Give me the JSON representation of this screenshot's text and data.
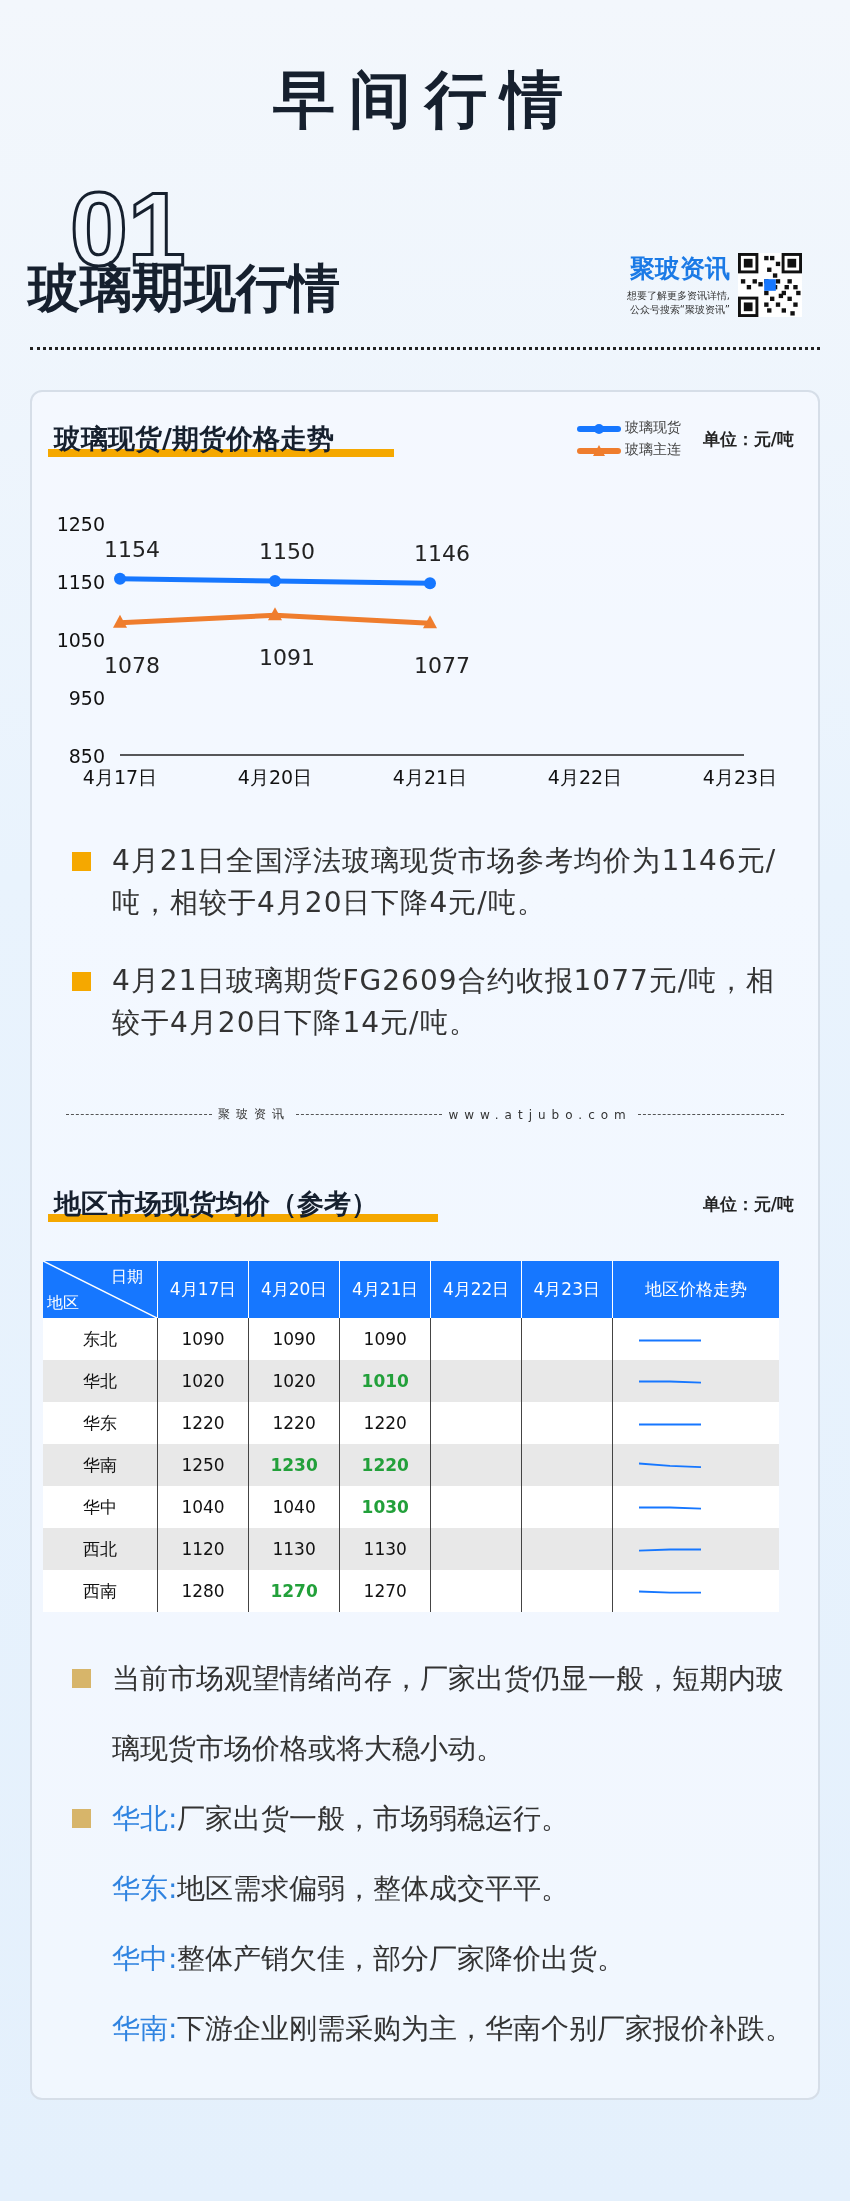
{
  "page_title": "早间行情",
  "section": {
    "number": "01",
    "title": "玻璃期现行情"
  },
  "brand": {
    "name": "聚玻资讯",
    "lines": [
      "想要了解更多资讯详情,",
      "公众号搜索“聚玻资讯”"
    ]
  },
  "price_chart": {
    "heading": "玻璃现货/期货价格走势",
    "unit": "单位：元/吨",
    "chart_data": {
      "type": "line",
      "categories": [
        "4月17日",
        "4月20日",
        "4月21日",
        "4月22日",
        "4月23日"
      ],
      "ylim": [
        850,
        1250
      ],
      "yticks": [
        850,
        950,
        1050,
        1150,
        1250
      ],
      "data_labels": true,
      "series": [
        {
          "name": "玻璃现货",
          "color": "#1677ff",
          "marker": "circle",
          "values": [
            1154,
            1150,
            1146,
            null,
            null
          ]
        },
        {
          "name": "玻璃主连",
          "color": "#ef7d2d",
          "marker": "triangle",
          "values": [
            1078,
            1091,
            1077,
            null,
            null
          ]
        }
      ]
    }
  },
  "summary_bullets": [
    "4月21日全国浮法玻璃现货市场参考均价为1146元/吨，相较于4月20日下降4元/吨。",
    "4月21日玻璃期货FG2609合约收报1077元/吨，相较于4月20日下降14元/吨。"
  ],
  "divider": {
    "brand": "聚玻资讯",
    "site": "www.atjubo.com"
  },
  "region_table": {
    "heading": "地区市场现货均价（参考）",
    "unit": "单位：元/吨",
    "corner_top": "日期",
    "corner_bottom": "地区",
    "columns": [
      "4月17日",
      "4月20日",
      "4月21日",
      "4月22日",
      "4月23日"
    ],
    "trend_column": "地区价格走势",
    "rows": [
      {
        "region": "东北",
        "cells": [
          {
            "value": "1090",
            "down": false
          },
          {
            "value": "1090",
            "down": false
          },
          {
            "value": "1090",
            "down": false
          }
        ]
      },
      {
        "region": "华北",
        "cells": [
          {
            "value": "1020",
            "down": false
          },
          {
            "value": "1020",
            "down": false
          },
          {
            "value": "1010",
            "down": true
          }
        ]
      },
      {
        "region": "华东",
        "cells": [
          {
            "value": "1220",
            "down": false
          },
          {
            "value": "1220",
            "down": false
          },
          {
            "value": "1220",
            "down": false
          }
        ]
      },
      {
        "region": "华南",
        "cells": [
          {
            "value": "1250",
            "down": false
          },
          {
            "value": "1230",
            "down": true
          },
          {
            "value": "1220",
            "down": true
          }
        ]
      },
      {
        "region": "华中",
        "cells": [
          {
            "value": "1040",
            "down": false
          },
          {
            "value": "1040",
            "down": false
          },
          {
            "value": "1030",
            "down": true
          }
        ]
      },
      {
        "region": "西北",
        "cells": [
          {
            "value": "1120",
            "down": false
          },
          {
            "value": "1130",
            "down": false
          },
          {
            "value": "1130",
            "down": false
          }
        ]
      },
      {
        "region": "西南",
        "cells": [
          {
            "value": "1280",
            "down": false
          },
          {
            "value": "1270",
            "down": true
          },
          {
            "value": "1270",
            "down": false
          }
        ]
      }
    ]
  },
  "outlook": "当前市场观望情绪尚存，厂家出货仍显一般，短期内玻璃现货市场价格或将大稳小动。",
  "region_notes": [
    {
      "region": "华北:",
      "text": "厂家出货一般，市场弱稳运行。",
      "bullet": true
    },
    {
      "region": "华东:",
      "text": "地区需求偏弱，整体成交平平。",
      "bullet": false
    },
    {
      "region": "华中:",
      "text": "整体产销欠佳，部分厂家降价出货。",
      "bullet": false
    },
    {
      "region": "华南:",
      "text": "下游企业刚需采购为主，华南个别厂家报价补跌。",
      "bullet": false
    }
  ]
}
